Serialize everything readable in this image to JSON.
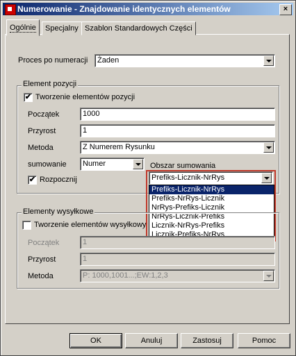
{
  "window": {
    "title": "Numerowanie - Znajdowanie identycznych elementów",
    "close_glyph": "×"
  },
  "tabs": [
    {
      "label": "Ogólnie",
      "active": true
    },
    {
      "label": "Specjalny",
      "active": false
    },
    {
      "label": "Szablon Standardowych Części",
      "active": false
    }
  ],
  "process": {
    "label": "Proces po numeracji",
    "value": "Żaden"
  },
  "element_pozycji": {
    "title": "Element pozycji",
    "create_label": "Tworzenie elementów pozycji",
    "create_checked": "✔",
    "start_label": "Początek",
    "start_value": "1000",
    "step_label": "Przyrost",
    "step_value": "1",
    "method_label": "Metoda",
    "method_value": "Z Numerem Rysunku",
    "sum_label": "sumowanie",
    "sum_value": "Numer",
    "start_cb_label": "Rozpocznij",
    "start_cb_checked": "✔",
    "area_label": "Obszar sumowania",
    "area_value": "Prefiks-Licznik-NrRys",
    "area_options": [
      "Prefiks-Licznik-NrRys",
      "Prefiks-NrRys-Licznik",
      "NrRys-Prefiks-Licznik",
      "NrRys-Licznik-Prefiks",
      "Licznik-NrRys-Prefiks",
      "Licznik-Prefiks-NrRys"
    ]
  },
  "elementy_wysylkowe": {
    "title": "Elementy wysyłkowe",
    "create_label": "Tworzenie elementów wysyłkowy",
    "start_label": "Początek",
    "start_value": "1",
    "step_label": "Przyrost",
    "step_value": "1",
    "method_label": "Metoda",
    "method_value": "P: 1000,1001...;EW:1,2,3"
  },
  "buttons": {
    "ok": "OK",
    "cancel": "Anuluj",
    "save": "Zastosuj",
    "help": "Pomoc"
  }
}
